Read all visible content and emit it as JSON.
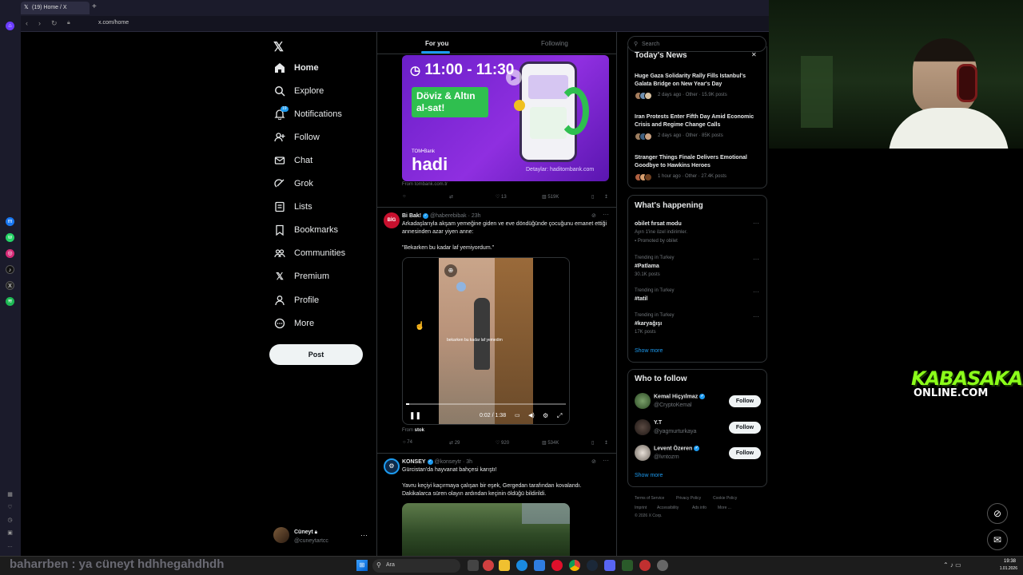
{
  "browser": {
    "tab_title": "(19) Home / X",
    "url": "x.com/home"
  },
  "nav": {
    "items": [
      {
        "label": "Home",
        "icon": "home-icon"
      },
      {
        "label": "Explore",
        "icon": "search-icon"
      },
      {
        "label": "Notifications",
        "icon": "bell-icon"
      },
      {
        "label": "Follow",
        "icon": "add-person-icon"
      },
      {
        "label": "Chat",
        "icon": "mail-icon"
      },
      {
        "label": "Grok",
        "icon": "grok-icon"
      },
      {
        "label": "Lists",
        "icon": "list-icon"
      },
      {
        "label": "Bookmarks",
        "icon": "bookmark-icon"
      },
      {
        "label": "Communities",
        "icon": "people-icon"
      },
      {
        "label": "Premium",
        "icon": "x-logo-icon"
      },
      {
        "label": "Profile",
        "icon": "person-icon"
      },
      {
        "label": "More",
        "icon": "more-circle-icon"
      }
    ],
    "notification_badge": "19",
    "post_label": "Post",
    "account_name": "Cüneyt",
    "account_handle": "@cuneytartcc"
  },
  "feed": {
    "tabs": [
      "For you",
      "Following"
    ],
    "ad": {
      "time_text": "11:00 - 11:30",
      "slogan": "Döviz & Altın al-sat!",
      "brand_top": "TOM•Bank",
      "brand": "hadi",
      "disclaimer": "Detaylar: haditombank.com",
      "source": "From tombank.com.tr",
      "stats": {
        "likes": "13",
        "views": "519K"
      }
    },
    "tweets": [
      {
        "author": "Bi Bak!",
        "handle": "@haberebibak",
        "time": "· 23h",
        "text": "Arkadaşlarıyla akşam yemeğine giden ve eve döndüğünde çocuğunu emanet ettiği annesinden azar yiyen anne:",
        "quote": "\"Bekarken bu kadar laf yemiyordum.\"",
        "video_caption": "bekarken bu kadar laf yemedim",
        "video_time": "0:02 / 1:38",
        "from": "From",
        "from_source": "stok",
        "stats": {
          "replies": "74",
          "retweets": "29",
          "likes": "920",
          "views": "534K"
        }
      },
      {
        "author": "KONSEY",
        "handle": "@konseytr",
        "time": "· 3h",
        "text": "Gürcistan'da hayvanat bahçesi karıştı!",
        "body": "Yavru keçiyi kaçırmaya çalışan bir eşek, Gergedan tarafından kovalandı. Dakikalarca süren olayın ardından keçinin öldüğü bildirildi."
      }
    ]
  },
  "right": {
    "search_placeholder": "Search",
    "todays_news_title": "Today's News",
    "news": [
      {
        "headline": "Huge Gaza Solidarity Rally Fills Istanbul's Galata Bridge on New Year's Day",
        "meta": "2 days ago · Other · 15.9K posts"
      },
      {
        "headline": "Iran Protests Enter Fifth Day Amid Economic Crisis and Regime Change Calls",
        "meta": "2 days ago · Other · 85K posts"
      },
      {
        "headline": "Stranger Things Finale Delivers Emotional Goodbye to Hawkins Heroes",
        "meta": "1 hour ago · Other · 27.4K posts"
      }
    ],
    "happening_title": "What's happening",
    "promo": {
      "name": "obilet fırsat modu",
      "desc": "Ayın 1'ine özel indirimler.",
      "promoted": "Promoted by obilet"
    },
    "trends": [
      {
        "label": "Trending in Turkey",
        "name": "#Patlama",
        "count": "30.1K posts"
      },
      {
        "label": "Trending in Turkey",
        "name": "#tatil",
        "count": ""
      },
      {
        "label": "Trending in Turkey",
        "name": "#karyağışı",
        "count": "17K posts"
      }
    ],
    "show_more": "Show more",
    "wtf_title": "Who to follow",
    "follow_label": "Follow",
    "who_to_follow": [
      {
        "name": "Kemal Hiçyılmaz",
        "handle": "@CryptoKemal",
        "verified": true
      },
      {
        "name": "Y.T",
        "handle": "@yagmurturkaya",
        "verified": false
      },
      {
        "name": "Levent Özeren",
        "handle": "@lvntozrn",
        "verified": true
      }
    ],
    "footer": [
      "Terms of Service",
      "Privacy Policy",
      "Cookie Policy",
      "Imprint",
      "Accessibility",
      "Ads info",
      "More ...",
      "© 2026 X Corp."
    ]
  },
  "overlay": {
    "chat_line": "baharrben : ya cüneyt hdhhegahdhdh",
    "logo_line1": "KABASAKAL",
    "logo_line2": "ONLINE.COM"
  },
  "taskbar": {
    "search_placeholder": "Ara",
    "clock": "19:38",
    "date": "1.01.2026"
  },
  "colors": {
    "accent": "#1d9bf0",
    "background": "#000000",
    "border": "#2f3336",
    "ad_purple": "#8a2be2",
    "ad_green": "#2fbf4f",
    "logo_green": "#8cff1a"
  }
}
